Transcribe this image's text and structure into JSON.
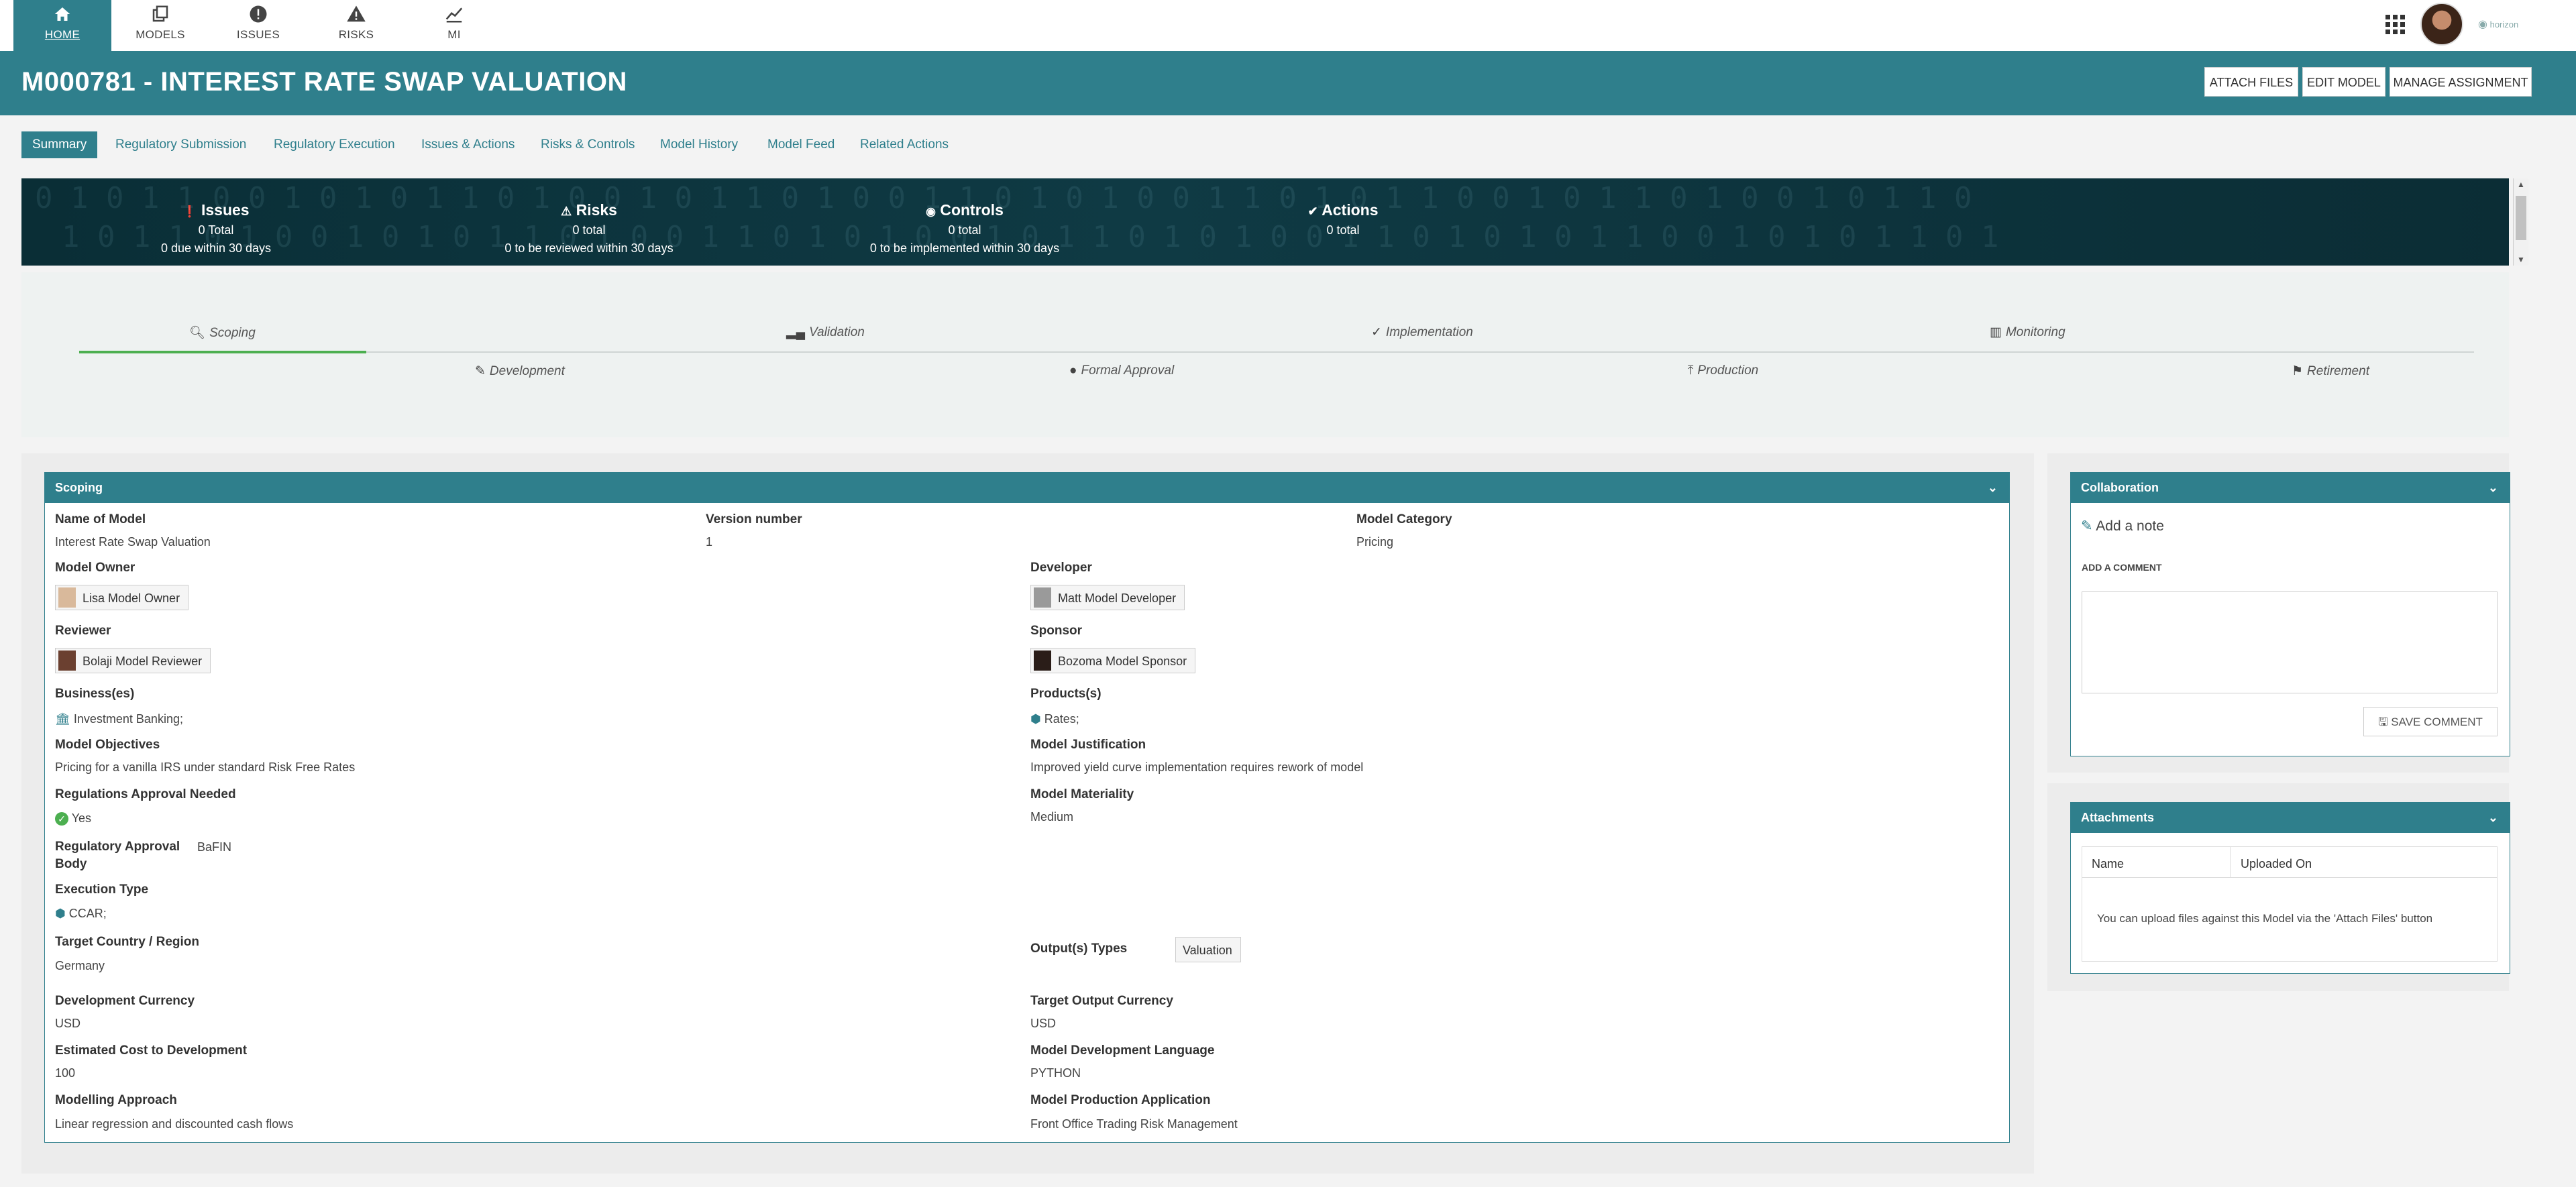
{
  "nav": {
    "items": [
      {
        "label": "HOME",
        "icon": "home-icon"
      },
      {
        "label": "MODELS",
        "icon": "models-icon"
      },
      {
        "label": "ISSUES",
        "icon": "issues-icon"
      },
      {
        "label": "RISKS",
        "icon": "risks-icon"
      },
      {
        "label": "MI",
        "icon": "chart-icon"
      }
    ],
    "brand": "horizon"
  },
  "header": {
    "title": "M000781 - INTEREST RATE SWAP VALUATION",
    "buttons": [
      "ATTACH FILES",
      "EDIT MODEL",
      "MANAGE ASSIGNMENT"
    ]
  },
  "tabs": [
    "Summary",
    "Regulatory Submission",
    "Regulatory Execution",
    "Issues & Actions",
    "Risks & Controls",
    "Model History",
    "Model Feed",
    "Related Actions"
  ],
  "stats": [
    {
      "title": "Issues",
      "icon": "exclamation-icon",
      "line1": "0 Total",
      "line2": "0 due within 30 days"
    },
    {
      "title": "Risks",
      "icon": "warning-icon",
      "line1": "0 total",
      "line2": "0 to be reviewed within 30 days"
    },
    {
      "title": "Controls",
      "icon": "eye-icon",
      "line1": "0 total",
      "line2": "0 to be implemented within 30 days"
    },
    {
      "title": "Actions",
      "icon": "check-icon",
      "line1": "0 total",
      "line2": ""
    }
  ],
  "lifecycle": {
    "top": [
      "Scoping",
      "Validation",
      "Implementation",
      "Monitoring"
    ],
    "bottom": [
      "Development",
      "Formal Approval",
      "Production",
      "Retirement"
    ],
    "active": "Scoping"
  },
  "scoping": {
    "title": "Scoping",
    "name_label": "Name of Model",
    "name_value": "Interest Rate Swap Valuation",
    "version_label": "Version number",
    "version_value": "1",
    "category_label": "Model Category",
    "category_value": "Pricing",
    "owner_label": "Model Owner",
    "owner_value": "Lisa Model Owner",
    "developer_label": "Developer",
    "developer_value": "Matt Model Developer",
    "reviewer_label": "Reviewer",
    "reviewer_value": "Bolaji Model Reviewer",
    "sponsor_label": "Sponsor",
    "sponsor_value": "Bozoma Model Sponsor",
    "business_label": "Business(es)",
    "business_value": "Investment Banking;",
    "products_label": "Products(s)",
    "products_value": "Rates;",
    "objectives_label": "Model Objectives",
    "objectives_value": "Pricing for a vanilla IRS under standard Risk Free Rates",
    "justification_label": "Model Justification",
    "justification_value": "Improved yield curve implementation requires rework of model",
    "reg_needed_label": "Regulations Approval Needed",
    "reg_needed_value": "Yes",
    "materiality_label": "Model Materiality",
    "materiality_value": "Medium",
    "reg_body_label_1": "Regulatory Approval",
    "reg_body_label_2": "Body",
    "reg_body_value": "BaFIN",
    "execution_label": "Execution Type",
    "execution_value": "CCAR;",
    "country_label": "Target Country / Region",
    "country_value": "Germany",
    "output_types_label": "Output(s) Types",
    "output_types_value": "Valuation",
    "dev_currency_label": "Development Currency",
    "dev_currency_value": "USD",
    "target_currency_label": "Target Output Currency",
    "target_currency_value": "USD",
    "cost_label": "Estimated Cost to Development",
    "cost_value": "100",
    "language_label": "Model Development Language",
    "language_value": "PYTHON",
    "approach_label": "Modelling Approach",
    "approach_value": "Linear regression and discounted cash flows",
    "prod_app_label": "Model Production Application",
    "prod_app_value": "Front Office Trading Risk Management"
  },
  "collaboration": {
    "title": "Collaboration",
    "add_note": "Add a note",
    "add_comment_label": "ADD A COMMENT",
    "save_label": "SAVE COMMENT"
  },
  "attachments": {
    "title": "Attachments",
    "col_name": "Name",
    "col_uploaded": "Uploaded On",
    "empty": "You can upload files against this Model via the 'Attach Files' button"
  },
  "colors": {
    "primary": "#2f7f8c",
    "banner": "#0f3a44",
    "progress": "#4caf50"
  }
}
